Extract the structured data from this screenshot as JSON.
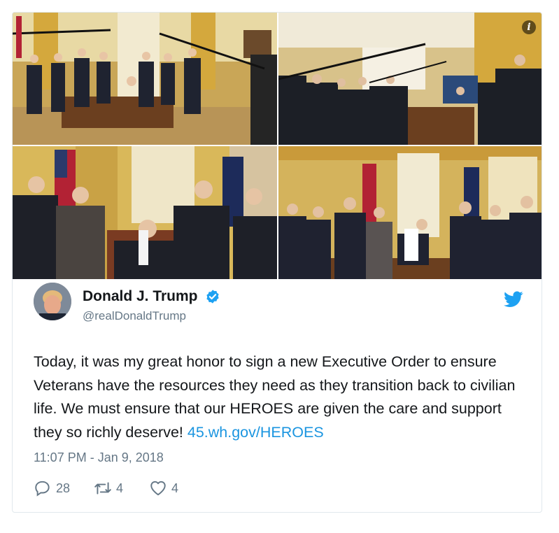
{
  "tweet": {
    "display_name": "Donald J. Trump",
    "handle": "@realDonaldTrump",
    "text_main": "Today, it was my great honor to sign a new Executive Order to ensure Veterans have the resources they need as they transition back to civilian life. We must ensure that our HEROES are given the care and support they so richly deserve! ",
    "link_text": "45.wh.gov/HEROES",
    "timestamp": "11:07 PM - Jan 9, 2018",
    "replies": "28",
    "retweets": "4",
    "likes": "4"
  },
  "colors": {
    "link": "#1b95e0",
    "verified": "#1da1f2",
    "secondary_text": "#657786",
    "border": "#e1e8ed"
  },
  "icons": {
    "info": "info-icon",
    "verified": "verified-badge-icon",
    "brand": "twitter-bird-icon",
    "reply": "reply-icon",
    "retweet": "retweet-icon",
    "like": "heart-icon"
  }
}
